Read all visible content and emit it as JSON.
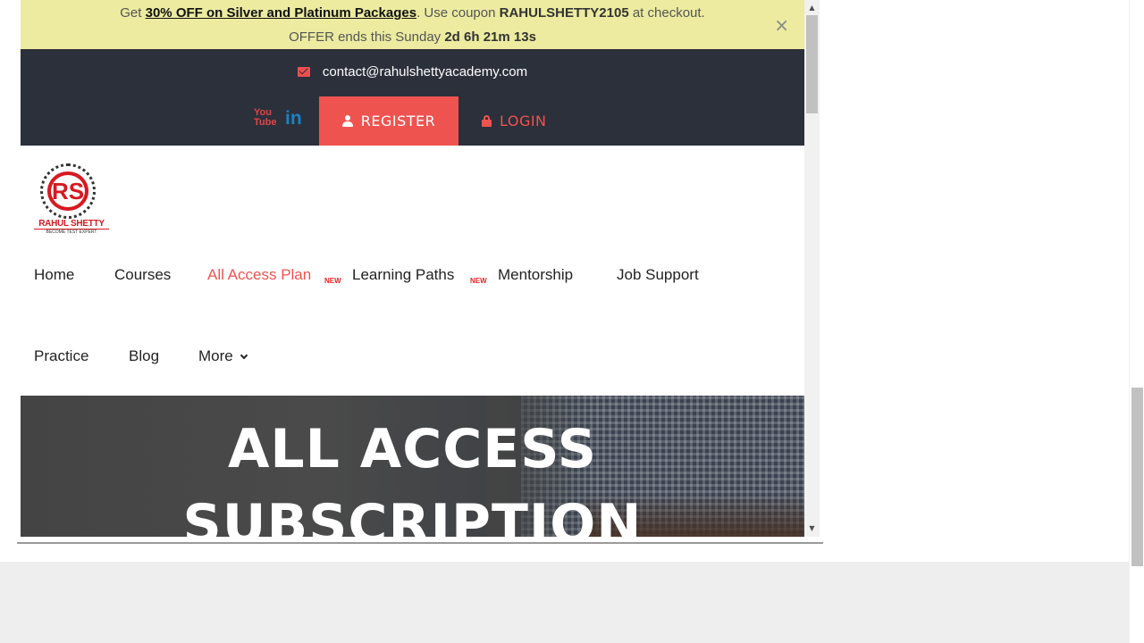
{
  "promo": {
    "prefix": "Get ",
    "offer_link": "30% OFF on Silver and Platinum Packages",
    "coupon_text": ". Use coupon ",
    "coupon_code": "RAHULSHETTY2105",
    "suffix": " at checkout.",
    "ends_text": "OFFER ends this Sunday ",
    "countdown": "2d 6h 21m 13s",
    "close_symbol": "×"
  },
  "topbar": {
    "email": "contact@rahulshettyacademy.com",
    "youtube_icon_text": "You Tube",
    "linkedin_icon_text": "in",
    "register_label": "REGISTER",
    "login_label": "LOGIN"
  },
  "logo": {
    "monogram": "RS",
    "name": "RAHUL SHETTY",
    "tagline": "BECOME TEST EXPERT"
  },
  "nav": {
    "items": [
      {
        "label": "Home"
      },
      {
        "label": "Courses"
      },
      {
        "label": "All Access Plan",
        "badge": "NEW"
      },
      {
        "label": "Learning Paths",
        "badge": "NEW"
      },
      {
        "label": "Mentorship"
      },
      {
        "label": "Job Support"
      },
      {
        "label": "Practice"
      },
      {
        "label": "Blog"
      },
      {
        "label": "More"
      }
    ]
  },
  "hero": {
    "title_line1": "ALL ACCESS",
    "title_line2": "SUBSCRIPTION"
  },
  "scroll": {
    "up_arrow": "▲",
    "down_arrow": "▼"
  },
  "colors": {
    "accent": "#ef5350",
    "topbar_bg": "#2b303b",
    "promo_bg": "#eceba0",
    "logo_red": "#d71920"
  },
  "icons": [
    "envelope-icon",
    "youtube-icon",
    "linkedin-icon",
    "user-icon",
    "lock-icon",
    "chevron-down-icon",
    "close-icon"
  ]
}
